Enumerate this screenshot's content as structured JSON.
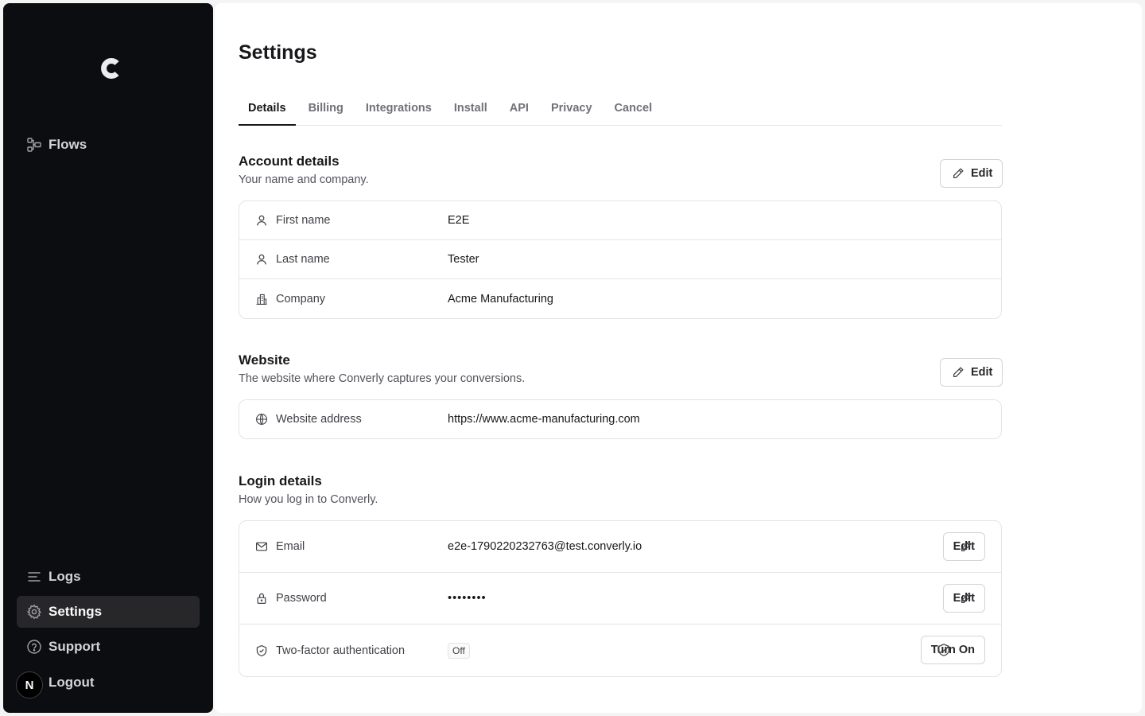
{
  "sidebar": {
    "logo_letter": "C",
    "items": [
      {
        "label": "Flows",
        "icon": "flows-icon"
      },
      {
        "label": "Logs",
        "icon": "logs-icon"
      },
      {
        "label": "Settings",
        "icon": "gear-icon"
      },
      {
        "label": "Support",
        "icon": "help-circle-icon"
      },
      {
        "label": "Logout",
        "icon": "avatar"
      }
    ],
    "avatar_letter": "N"
  },
  "page": {
    "title": "Settings",
    "tabs": [
      "Details",
      "Billing",
      "Integrations",
      "Install",
      "API",
      "Privacy",
      "Cancel"
    ],
    "active_tab": "Details"
  },
  "account": {
    "title": "Account details",
    "desc": "Your name and company.",
    "edit_label": "Edit",
    "rows": [
      {
        "label": "First name",
        "value": "E2E",
        "icon": "user-icon"
      },
      {
        "label": "Last name",
        "value": "Tester",
        "icon": "user-icon"
      },
      {
        "label": "Company",
        "value": "Acme Manufacturing",
        "icon": "building-icon"
      }
    ]
  },
  "website": {
    "title": "Website",
    "desc": "The website where Converly captures your conversions.",
    "edit_label": "Edit",
    "rows": [
      {
        "label": "Website address",
        "value": "https://www.acme-manufacturing.com",
        "icon": "globe-icon"
      }
    ]
  },
  "login": {
    "title": "Login details",
    "desc": "How you log in to Converly.",
    "email_label": "Email",
    "email_value": "e2e-1790220232763@test.converly.io",
    "email_edit": "Edit",
    "password_label": "Password",
    "password_value": "••••••••",
    "password_edit": "Edit",
    "twofa_label": "Two-factor authentication",
    "twofa_status": "Off",
    "twofa_button": "Turn On"
  },
  "colors": {
    "sidebar_bg": "#0c0d11",
    "active_nav_bg": "#27272a",
    "border": "#e4e4e7"
  }
}
